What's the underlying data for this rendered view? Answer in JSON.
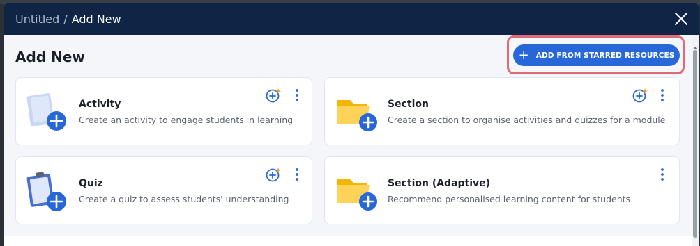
{
  "breadcrumb": {
    "parent": "Untitled",
    "separator": "/",
    "current": "Add New"
  },
  "header": {
    "close_icon": "close-icon"
  },
  "page": {
    "title": "Add New"
  },
  "starred_button": {
    "label": "ADD FROM STARRED RESOURCES",
    "icon": "plus-icon"
  },
  "cards": [
    {
      "title": "Activity",
      "description": "Create an activity to engage students in learning",
      "icon": "activity-icon"
    },
    {
      "title": "Section",
      "description": "Create a section to organise activities and quizzes for a module",
      "icon": "folder-icon"
    },
    {
      "title": "Quiz",
      "description": "Create a quiz to assess students' understanding",
      "icon": "clipboard-icon"
    },
    {
      "title": "Section (Adaptive)",
      "description": "Recommend personalised learning content for students",
      "icon": "folder-icon"
    }
  ],
  "colors": {
    "header": "#0f2545",
    "accent": "#2867d8",
    "highlight": "#e06a78",
    "spark": "#f39a2b"
  }
}
